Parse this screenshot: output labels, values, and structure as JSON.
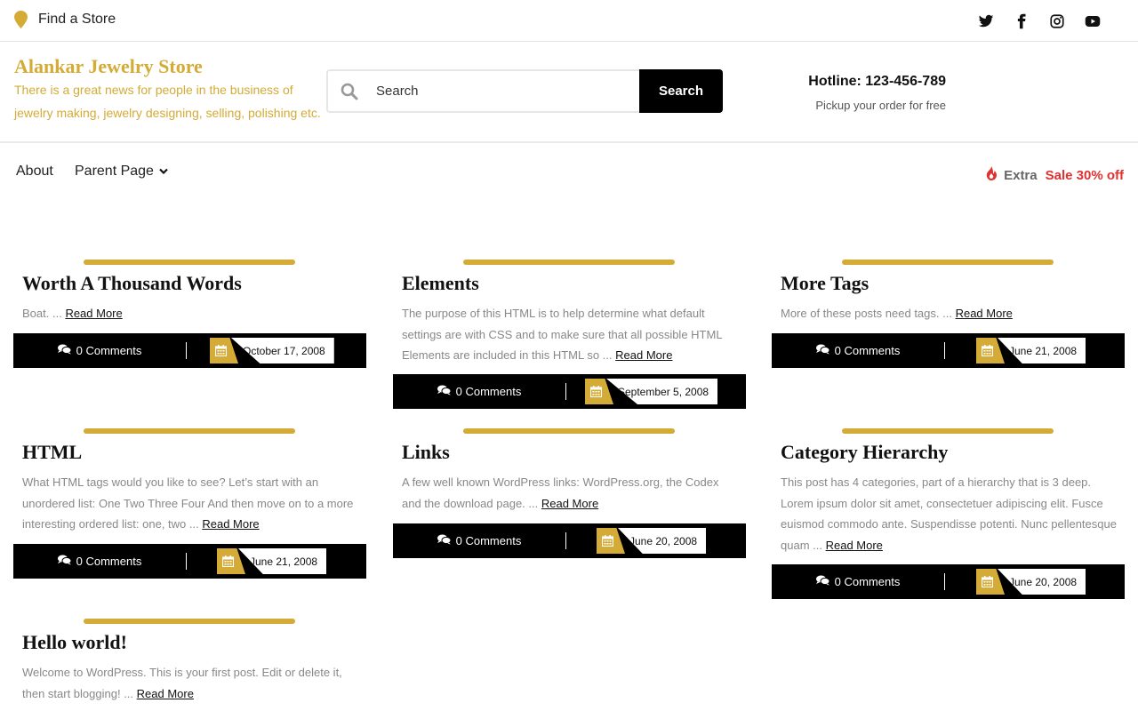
{
  "topbar": {
    "find_store": "Find a Store",
    "socials": [
      "twitter-icon",
      "facebook-icon",
      "instagram-icon",
      "youtube-icon"
    ]
  },
  "header": {
    "site_title": "Alankar Jewelry Store",
    "site_description": "There is a great news for people in the business of jewelry making, jewelry designing, selling, polishing etc.",
    "search_placeholder": "Search",
    "search_button": "Search",
    "hotline": "Hotline: 123-456-789",
    "hotline_sub": "Pickup your order for free"
  },
  "nav": {
    "items": [
      {
        "label": "About"
      },
      {
        "label": "Parent Page"
      }
    ],
    "sale_extra": "Extra",
    "sale_text": "Sale 30% off"
  },
  "colors": {
    "accent": "#d4ab36",
    "sale": "#e03131",
    "meta_bg": "#000000"
  },
  "read_more": "Read More",
  "posts": [
    {
      "title": "Worth A Thousand Words",
      "excerpt": "Boat. ...",
      "comments": "0 Comments",
      "date": "October 17, 2008"
    },
    {
      "title": "Elements",
      "excerpt": "The purpose of this HTML is to help determine what default settings are with CSS and to make sure that all possible HTML Elements are included in this HTML so ...",
      "comments": "0 Comments",
      "date": "September 5, 2008"
    },
    {
      "title": "More Tags",
      "excerpt": "More of these posts need tags. ...",
      "comments": "0 Comments",
      "date": "June 21, 2008"
    },
    {
      "title": "HTML",
      "excerpt": "What HTML tags would you like to see? Let’s start with an unordered list: One Two Three Four And then move on to a more interesting ordered list: one, two ...",
      "comments": "0 Comments",
      "date": "June 21, 2008"
    },
    {
      "title": "Links",
      "excerpt": "A few well known WordPress links: WordPress.org, the Codex and the download page. ...",
      "comments": "0 Comments",
      "date": "June 20, 2008"
    },
    {
      "title": "Category Hierarchy",
      "excerpt": "This post has 4 categories, part of a hierarchy that is 3 deep. Lorem ipsum dolor sit amet, consectetuer adipiscing elit. Fusce euismod commodo ante. Suspendisse potenti. Nunc pellentesque quam ...",
      "comments": "0 Comments",
      "date": "June 20, 2008"
    },
    {
      "title": "Hello world!",
      "excerpt": "Welcome to WordPress. This is your first post. Edit or delete it, then start blogging! ...",
      "comments": "0 Comments",
      "date": ""
    }
  ]
}
